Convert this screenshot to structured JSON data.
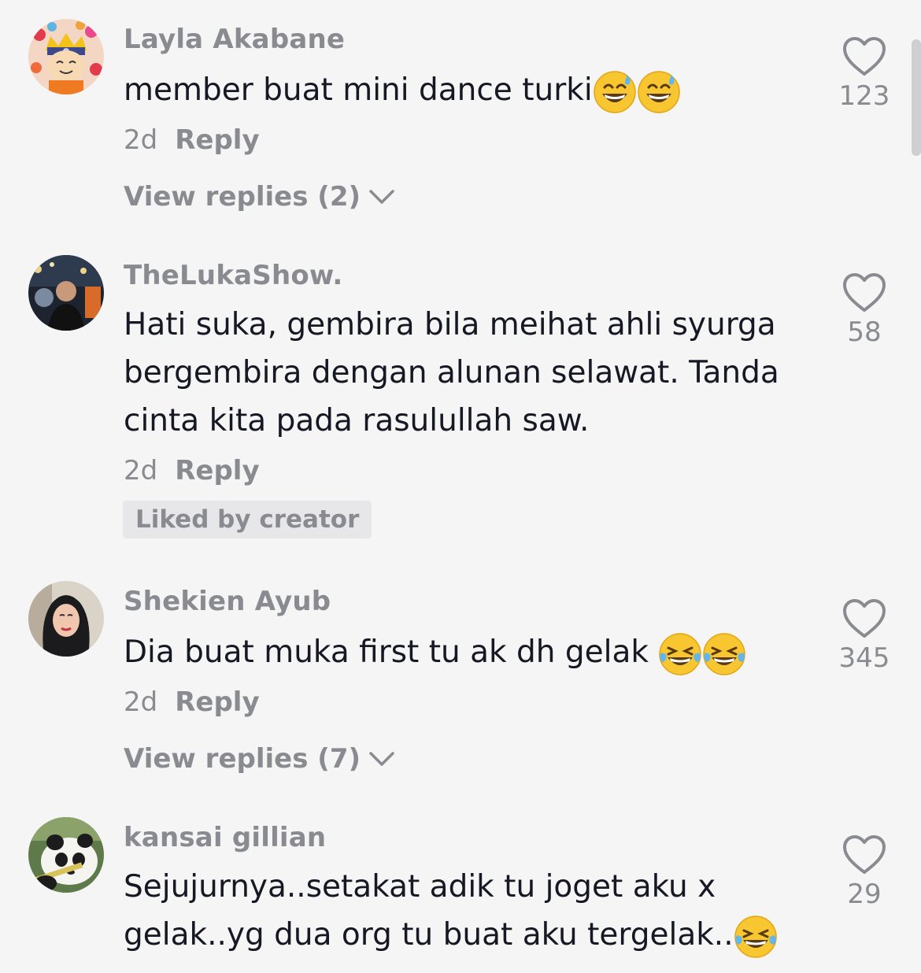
{
  "comments": [
    {
      "username": "Layla Akabane",
      "text": "member buat mini dance turki",
      "emojis": [
        "grinning-sweat-emoji",
        "grinning-sweat-emoji"
      ],
      "time": "2d",
      "reply_label": "Reply",
      "likes": "123",
      "view_replies": "View replies (2)"
    },
    {
      "username": "TheLukaShow.",
      "text": "Hati suka, gembira bila meihat ahli syurga\nbergembira dengan alunan selawat. Tanda\ncinta kita pada rasulullah saw.",
      "time": "2d",
      "reply_label": "Reply",
      "likes": "58",
      "badge": "Liked by creator"
    },
    {
      "username": "Shekien Ayub",
      "text": "Dia buat muka first tu ak dh gelak ",
      "emojis": [
        "tears-of-joy-emoji",
        "tears-of-joy-emoji"
      ],
      "time": "2d",
      "reply_label": "Reply",
      "likes": "345",
      "view_replies": "View replies (7)"
    },
    {
      "username": "kansai gillian",
      "text": "Sejujurnya..setakat adik tu joget aku x\ngelak..yg dua org tu buat aku tergelak..",
      "emojis": [
        "tears-of-joy-emoji"
      ],
      "likes": "29"
    }
  ],
  "colors": {
    "background": "#f5f5f5",
    "secondary_text": "#8a8b91",
    "primary_text": "#161823"
  }
}
